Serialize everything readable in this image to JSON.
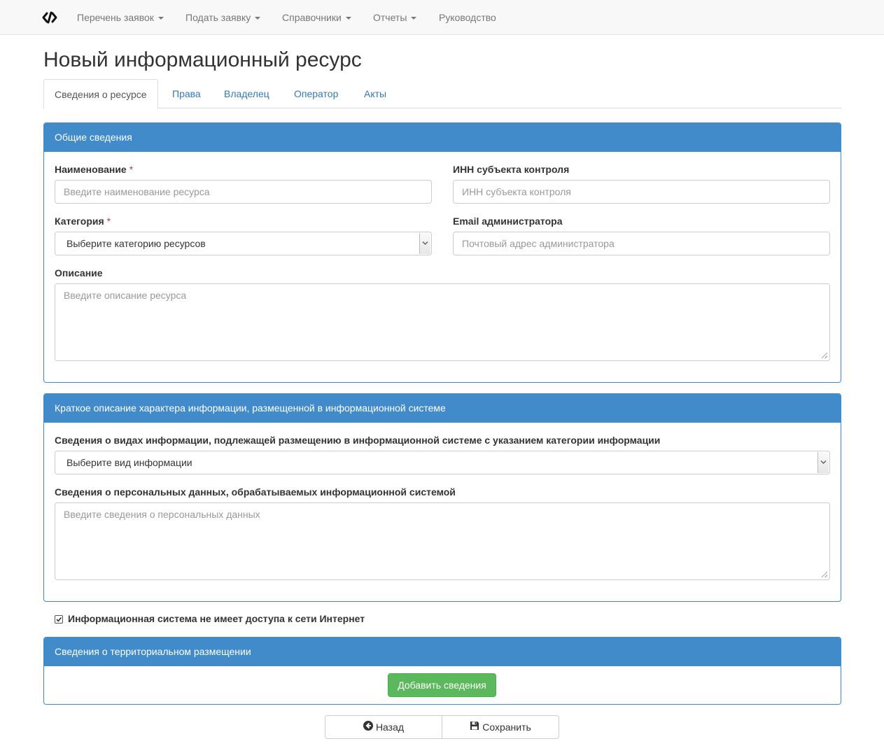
{
  "navbar": {
    "brand_icon": "code-logo-icon",
    "items": [
      {
        "label": "Перечень заявок",
        "dropdown": true
      },
      {
        "label": "Подать заявку",
        "dropdown": true
      },
      {
        "label": "Справочники",
        "dropdown": true
      },
      {
        "label": "Отчеты",
        "dropdown": true
      },
      {
        "label": "Руководство",
        "dropdown": false
      }
    ]
  },
  "page": {
    "title": "Новый информационный ресурс"
  },
  "tabs": [
    {
      "label": "Сведения о ресурсе",
      "active": true
    },
    {
      "label": "Права",
      "active": false
    },
    {
      "label": "Владелец",
      "active": false
    },
    {
      "label": "Оператор",
      "active": false
    },
    {
      "label": "Акты",
      "active": false
    }
  ],
  "general": {
    "heading": "Общие сведения",
    "name_label": "Наименование",
    "name_placeholder": "Введите наименование ресурса",
    "inn_label": "ИНН субъекта контроля",
    "inn_placeholder": "ИНН субъекта контроля",
    "category_label": "Категория",
    "category_value": "Выберите категорию ресурсов",
    "email_label": "Email администратора",
    "email_placeholder": "Почтовый адрес администратора",
    "description_label": "Описание",
    "description_placeholder": "Введите описание ресурса",
    "required_mark": "*"
  },
  "info_nature": {
    "heading": "Краткое описание характера информации, размещенной в информационной системе",
    "kinds_label": "Сведения о видах информации, подлежащей размещению в информационной системе с указанием категории информации",
    "kinds_value": "Выберите вид информации",
    "personal_label": "Сведения о персональных данных, обрабатываемых информационной системой",
    "personal_placeholder": "Введите сведения о персональных данных"
  },
  "internet_checkbox": {
    "label": "Информационная система не имеет доступа к сети Интернет",
    "checked": true
  },
  "territorial": {
    "heading": "Сведения о территориальном размещении",
    "add_button": "Добавить сведения"
  },
  "actions": {
    "back_label": "Назад",
    "save_label": "Сохранить"
  },
  "colors": {
    "primary": "#428bca",
    "success": "#5cb85c",
    "link": "#337ab7"
  }
}
